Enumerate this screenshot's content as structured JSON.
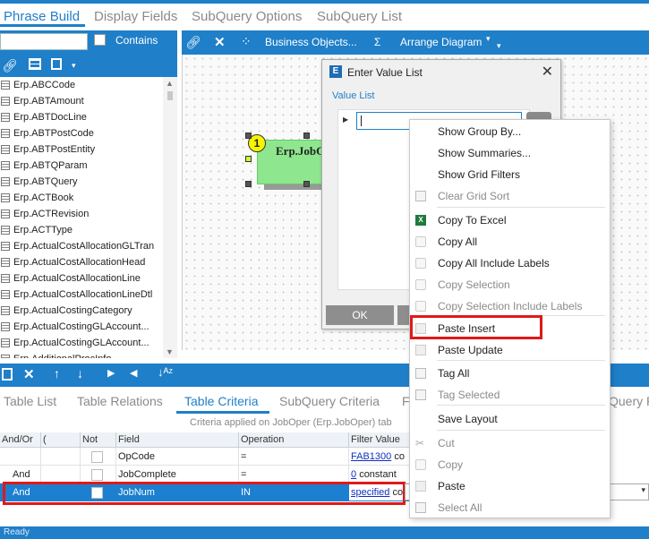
{
  "top_tabs": [
    "Phrase Build",
    "Display Fields",
    "SubQuery Options",
    "SubQuery List"
  ],
  "left_panel": {
    "contains_label": "Contains",
    "tables": [
      "Erp.ABCCode",
      "Erp.ABTAmount",
      "Erp.ABTDocLine",
      "Erp.ABTPostCode",
      "Erp.ABTPostEntity",
      "Erp.ABTQParam",
      "Erp.ABTQuery",
      "Erp.ACTBook",
      "Erp.ACTRevision",
      "Erp.ACTType",
      "Erp.ActualCostAllocationGLTran",
      "Erp.ActualCostAllocationHead",
      "Erp.ActualCostAllocationLine",
      "Erp.ActualCostAllocationLineDtl",
      "Erp.ActualCostingCategory",
      "Erp.ActualCostingGLAccount...",
      "Erp.ActualCostingGLAccount...",
      "Erp.AdditionalProcInfo"
    ]
  },
  "diagram_toolbar": {
    "business_objects": "Business Objects...",
    "sigma": "Σ",
    "arrange": "Arrange Diagram"
  },
  "diagram": {
    "node_number": "1",
    "node_title": "Erp.JobO"
  },
  "dialog": {
    "title": "Enter Value List",
    "sublabel": "Value List",
    "ok": "OK",
    "close": "✕"
  },
  "bottom_tabs": [
    "Table List",
    "Table Relations",
    "Table Criteria",
    "SubQuery Criteria",
    "F",
    "Query Fi"
  ],
  "criteria_caption": "Criteria applied on JobOper (Erp.JobOper)  tab",
  "grid": {
    "headers": [
      "And/Or",
      "(",
      "Not",
      "Field",
      "Operation",
      "Filter Value"
    ],
    "rows": [
      {
        "andor": "",
        "field": "OpCode",
        "op": "=",
        "value_link": "FAB1300",
        "value_tail": "co"
      },
      {
        "andor": "And",
        "field": "JobComplete",
        "op": "=",
        "value_link": "0",
        "value_tail": "constant"
      },
      {
        "andor": "And",
        "field": "JobNum",
        "op": "IN",
        "value_link": "specified",
        "value_tail": "co"
      }
    ]
  },
  "status_text": "Ready",
  "context_menu": [
    {
      "label": "Show Group By...",
      "disabled": false,
      "icon": ""
    },
    {
      "label": "Show Summaries...",
      "disabled": false,
      "icon": ""
    },
    {
      "label": "Show Grid Filters",
      "disabled": false,
      "icon": ""
    },
    {
      "label": "Clear Grid Sort",
      "disabled": true,
      "icon": "sheet"
    },
    {
      "label": "Copy To Excel",
      "disabled": false,
      "icon": "excel"
    },
    {
      "label": "Copy All",
      "disabled": false,
      "icon": "copy"
    },
    {
      "label": "Copy All Include Labels",
      "disabled": false,
      "icon": "copy"
    },
    {
      "label": "Copy Selection",
      "disabled": true,
      "icon": "copy"
    },
    {
      "label": "Copy Selection Include Labels",
      "disabled": true,
      "icon": "copy"
    },
    {
      "label": "Paste Insert",
      "disabled": false,
      "icon": "paste"
    },
    {
      "label": "Paste Update",
      "disabled": false,
      "icon": "paste"
    },
    {
      "label": "Tag All",
      "disabled": false,
      "icon": "sheet"
    },
    {
      "label": "Tag Selected",
      "disabled": true,
      "icon": "sheet"
    },
    {
      "label": "Save Layout",
      "disabled": false,
      "icon": ""
    },
    {
      "label": "Cut",
      "disabled": true,
      "icon": "cut"
    },
    {
      "label": "Copy",
      "disabled": true,
      "icon": "copy"
    },
    {
      "label": "Paste",
      "disabled": false,
      "icon": "paste"
    },
    {
      "label": "Select All",
      "disabled": true,
      "icon": "sheet"
    }
  ],
  "colors": {
    "accent": "#1f7fc9",
    "highlight": "#e01919",
    "node_fill": "#8ee68e",
    "selection": "#1d7fd0"
  }
}
